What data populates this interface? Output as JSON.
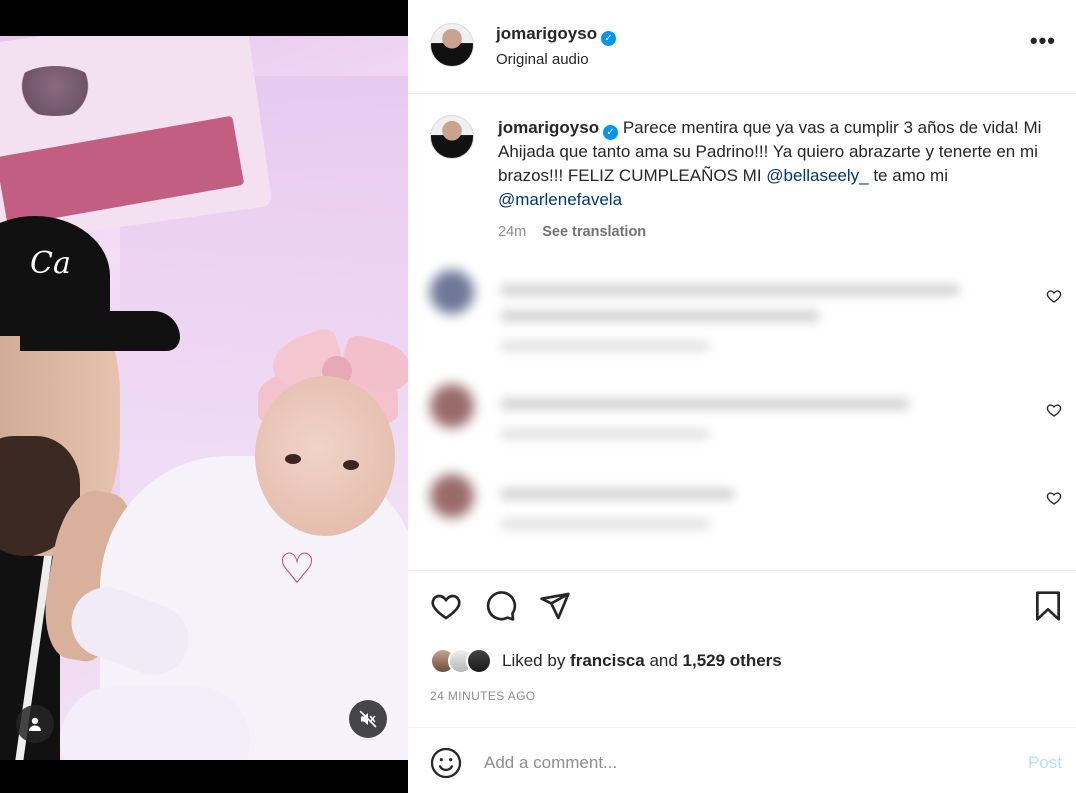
{
  "post": {
    "author": "jomarigoyso",
    "audio": "Original audio",
    "verified": true
  },
  "caption": {
    "author": "jomarigoyso",
    "text_1": " Parece mentira que ya vas a cumplir 3 años de vida! Mi Ahijada que tanto ama su Padrino!!! Ya quiero abrazarte y tenerte en mi brazos!!! FELIZ CUMPLEAÑOS MI ",
    "mention_1": "@bellaseely_",
    "text_2": " te amo mi ",
    "mention_2": "@marlenefavela",
    "time": "24m",
    "see_translation": "See translation"
  },
  "media": {
    "cap_text": "Ca",
    "user_icon": "user-icon",
    "mute_icon": "muted-speaker-icon"
  },
  "comments": [
    {
      "blurred": true
    },
    {
      "blurred": true
    },
    {
      "blurred": true
    }
  ],
  "likes": {
    "prefix": "Liked by ",
    "liker": "francisca",
    "middle": " and ",
    "count": "1,529 others"
  },
  "timestamp": "24 MINUTES AGO",
  "comment_box": {
    "placeholder": "Add a comment...",
    "post_label": "Post"
  },
  "colors": {
    "verified": "#0095f6",
    "mention": "#00376b",
    "post_disabled": "#b2dffc",
    "muted_text": "#8e8e8e"
  }
}
